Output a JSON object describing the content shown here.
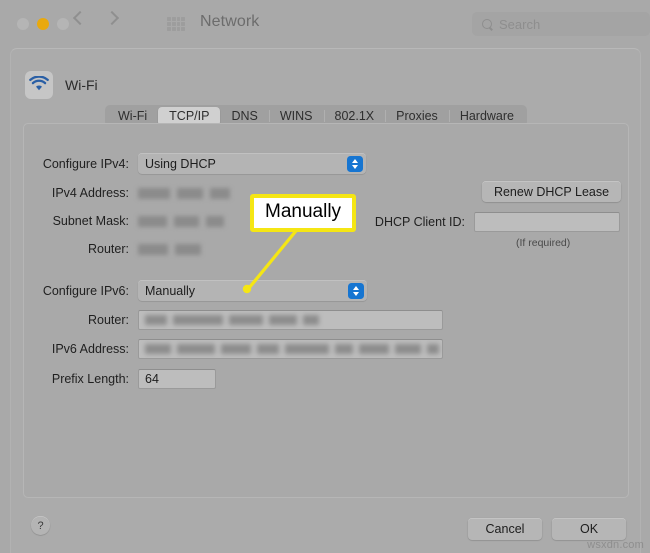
{
  "window": {
    "title": "Network",
    "traffic_lights": [
      "close",
      "minimize",
      "zoom"
    ],
    "nav_back": "back",
    "nav_forward": "forward",
    "grid_icon": "grid-icon",
    "search": {
      "placeholder": "Search",
      "value": ""
    }
  },
  "sheet": {
    "service_name": "Wi-Fi",
    "service_icon": "wifi-icon",
    "tabs": [
      {
        "label": "Wi-Fi",
        "selected": false
      },
      {
        "label": "TCP/IP",
        "selected": true
      },
      {
        "label": "DNS",
        "selected": false
      },
      {
        "label": "WINS",
        "selected": false
      },
      {
        "label": "802.1X",
        "selected": false
      },
      {
        "label": "Proxies",
        "selected": false
      },
      {
        "label": "Hardware",
        "selected": false
      }
    ]
  },
  "ipv4": {
    "configure_label": "Configure IPv4:",
    "configure_value": "Using DHCP",
    "address_label": "IPv4 Address:",
    "address_value": "",
    "subnet_label": "Subnet Mask:",
    "subnet_value": "",
    "router_label": "Router:",
    "router_value": "",
    "renew_button": "Renew DHCP Lease",
    "client_id_label": "DHCP Client ID:",
    "client_id_value": "",
    "client_id_hint": "(If required)"
  },
  "ipv6": {
    "configure_label": "Configure IPv6:",
    "configure_value": "Manually",
    "router_label": "Router:",
    "router_value": "",
    "address_label": "IPv6 Address:",
    "address_value": "",
    "prefix_label": "Prefix Length:",
    "prefix_value": "64"
  },
  "footer": {
    "help": "?",
    "cancel": "Cancel",
    "ok": "OK"
  },
  "annotation": {
    "callout_text": "Manually",
    "border_color": "#f5e614"
  },
  "watermark": "wsxdn.com"
}
